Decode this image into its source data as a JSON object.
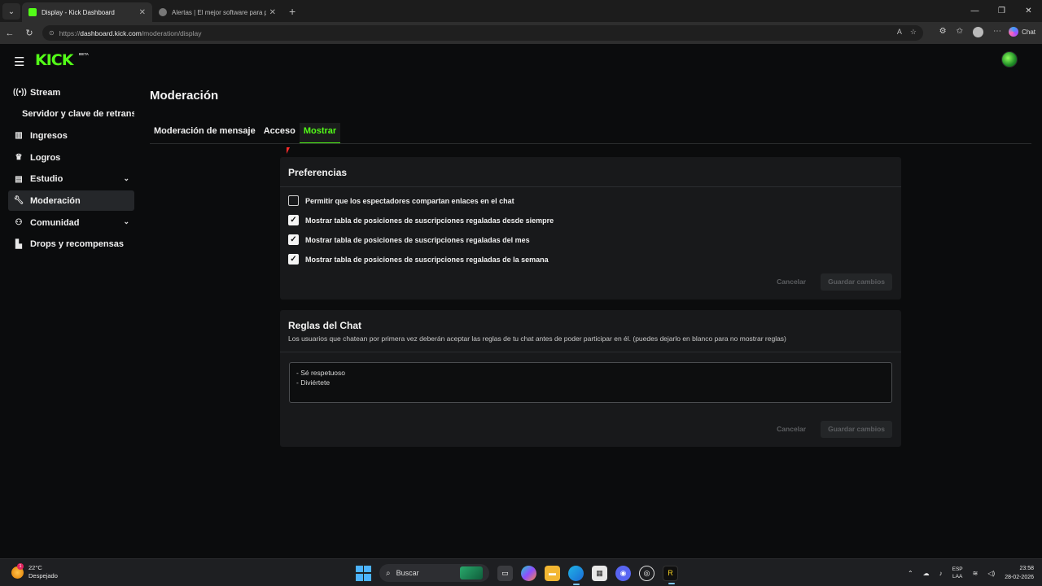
{
  "browser": {
    "tabs": [
      {
        "title": "Display - Kick Dashboard",
        "active": true
      },
      {
        "title": "Alertas | El mejor software para pr",
        "active": false
      }
    ],
    "url_prefix": "https://",
    "url_host": "dashboard.kick.com",
    "url_path": "/moderation/display",
    "chat_label": "Chat"
  },
  "header": {
    "logo": "KICK",
    "badge": "BETA"
  },
  "sidebar": {
    "items": [
      {
        "label": "Stream",
        "icon": "broadcast-icon"
      },
      {
        "label": "Servidor y clave de retransmi",
        "icon": ""
      },
      {
        "label": "Ingresos",
        "icon": "chart-icon"
      },
      {
        "label": "Logros",
        "icon": "trophy-icon"
      },
      {
        "label": "Estudio",
        "icon": "studio-icon"
      },
      {
        "label": "Moderación",
        "icon": "wrench-icon"
      },
      {
        "label": "Comunidad",
        "icon": "community-icon"
      },
      {
        "label": "Drops y recompensas",
        "icon": "gift-icon"
      }
    ]
  },
  "main": {
    "title": "Moderación",
    "tabs": [
      {
        "label": "Moderación de mensaje"
      },
      {
        "label": "Acceso"
      },
      {
        "label": "Mostrar"
      }
    ],
    "preferences": {
      "heading": "Preferencias",
      "options": [
        {
          "label": "Permitir que los espectadores compartan enlaces en el chat",
          "checked": false
        },
        {
          "label": "Mostrar tabla de posiciones de suscripciones regaladas desde siempre",
          "checked": true
        },
        {
          "label": "Mostrar tabla de posiciones de suscripciones regaladas del mes",
          "checked": true
        },
        {
          "label": "Mostrar tabla de posiciones de suscripciones regaladas de la semana",
          "checked": true
        }
      ],
      "cancel_label": "Cancelar",
      "save_label": "Guardar cambios"
    },
    "rules": {
      "heading": "Reglas del Chat",
      "description": "Los usuarios que chatean por primera vez deberán aceptar las reglas de tu chat antes de poder participar en él. (puedes dejarlo en blanco para no mostrar reglas)",
      "text": "- Sé respetuoso\n- Diviértete",
      "cancel_label": "Cancelar",
      "save_label": "Guardar cambios"
    }
  },
  "taskbar": {
    "temperature": "22°C",
    "weather": "Despejado",
    "search_placeholder": "Buscar",
    "lang_line1": "ESP",
    "lang_line2": "LAA",
    "time": "23:58",
    "date": "28-02-2026"
  },
  "colors": {
    "accent": "#53fc18",
    "background": "#0b0c0d",
    "card": "#18191b"
  }
}
